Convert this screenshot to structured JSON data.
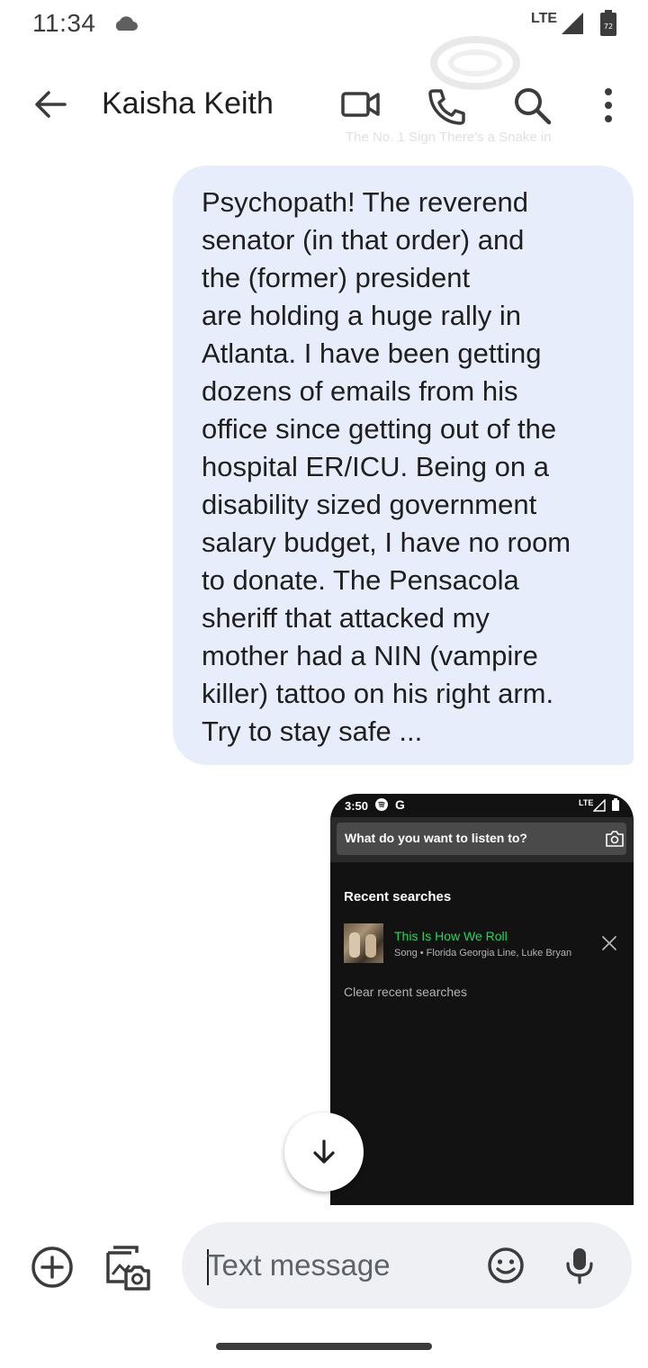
{
  "status_bar": {
    "time": "11:34",
    "network": "LTE",
    "battery": "72"
  },
  "background_preview": {
    "caption": "The No. 1 Sign There's a Snake in"
  },
  "header": {
    "contact_name": "Kaisha Keith",
    "icons": [
      "back-arrow-icon",
      "video-call-icon",
      "phone-icon",
      "search-icon",
      "more-vert-icon"
    ]
  },
  "message": {
    "text": "Psychopath! The reverend\nsenator (in that order) and\nthe (former) president\nare holding a huge rally in\nAtlanta. I have been getting\ndozens of emails from his\noffice since getting out of the\nhospital ER/ICU. Being on a\ndisability sized government\nsalary budget, I have no room\nto donate. The Pensacola\nsheriff that attacked my\nmother had a NIN (vampire\nkiller) tattoo on his right arm.\nTry to stay safe ..."
  },
  "attachment": {
    "status_time": "3:50",
    "status_g": "G",
    "status_network": "LTE",
    "search_placeholder": "What do you want to listen to?",
    "recent_title": "Recent searches",
    "recent_item_title": "This Is How We Roll",
    "recent_item_subtitle": "Song • Florida Georgia Line, Luke Bryan",
    "clear_label": "Clear recent searches",
    "accent_color": "#1ed760"
  },
  "composer": {
    "placeholder": "Text message"
  },
  "colors": {
    "bubble": "#e7edfa",
    "composer_bg": "#eef0f4"
  }
}
